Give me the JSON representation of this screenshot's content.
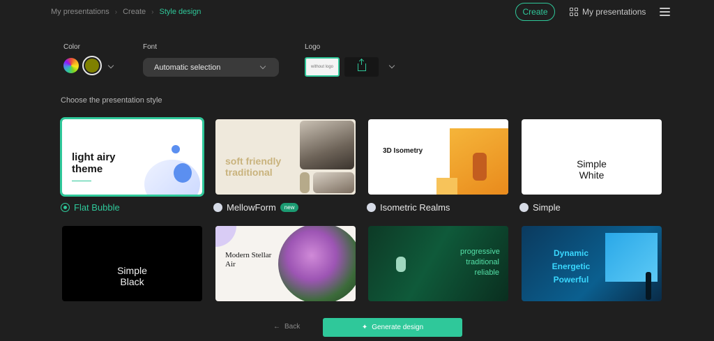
{
  "breadcrumbs": [
    "My presentations",
    "Create",
    "Style design"
  ],
  "header": {
    "create_label": "Create",
    "my_presentations_label": "My presentations"
  },
  "settings": {
    "color_label": "Color",
    "color_selected": "#7f8000",
    "font_label": "Font",
    "font_value": "Automatic selection",
    "logo_label": "Logo",
    "logo_none_label": "without logo"
  },
  "section_title": "Choose the presentation style",
  "styles": [
    {
      "name": "Flat Bubble",
      "selected": true,
      "preview_text": "light airy theme"
    },
    {
      "name": "MellowForm",
      "badge": "new",
      "preview_text": "soft friendly traditional"
    },
    {
      "name": "Isometric Realms",
      "preview_text": "3D Isometry"
    },
    {
      "name": "Simple",
      "preview_text": "Simple White"
    },
    {
      "preview_text": "Simple Black"
    },
    {
      "preview_text": "Modern Stellar Air"
    },
    {
      "preview_text": "progressive traditional reliable"
    },
    {
      "preview_text": "Dynamic Energetic Powerful"
    }
  ],
  "footer": {
    "back_label": "Back",
    "generate_label": "Generate design"
  },
  "colors": {
    "accent": "#2fc89a",
    "background": "#1f1f1f"
  }
}
